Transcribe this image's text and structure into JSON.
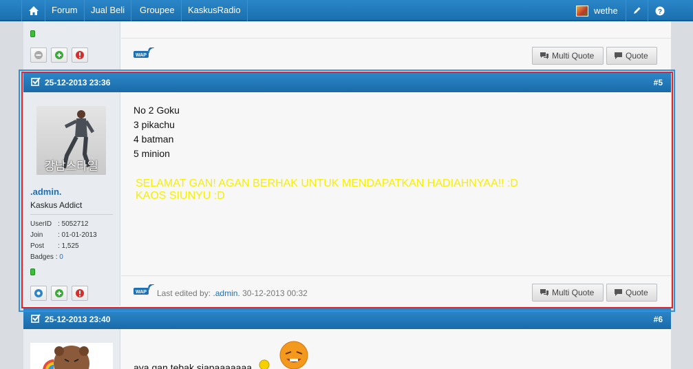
{
  "nav": {
    "items": [
      {
        "label": "Forum"
      },
      {
        "label": "Jual Beli"
      },
      {
        "label": "Groupee"
      },
      {
        "label": "KaskusRadio"
      }
    ],
    "username": "wethe"
  },
  "posts": [
    {
      "date": "25-12-2013 23:36",
      "number": "#5",
      "user": {
        "name": ".admin.",
        "rank": "Kaskus Addict",
        "avatar_caption": "강남스타일",
        "userid_label": "UserID",
        "userid": ": 5052712",
        "join_label": "Join",
        "join": ": 01-01-2013",
        "post_label": "Post",
        "post": ": 1,525",
        "badges_label": "Badges",
        "badges_sep": ":",
        "badges": "0"
      },
      "body_lines": [
        "No 2 Goku",
        "3 pikachu",
        "4 batman",
        "5 minion"
      ],
      "highlight_text_1": "SELAMAT GAN! AGAN BERHAK UNTUK MENDAPATKAN HADIAHNYAA!! :D",
      "highlight_text_2": "KAOS SIUNYU :D",
      "highlight_color": "#ffff00",
      "edited_prefix": "Last edited by:",
      "edited_user": ".admin.",
      "edited_date": "30-12-2013 00:32",
      "wap_label": "WAP",
      "multi_quote": "Multi Quote",
      "quote": "Quote"
    },
    {
      "date": "25-12-2013 23:40",
      "number": "#6",
      "body_partial": "aya gan tebak siapaaaaaaa"
    }
  ],
  "prev_post": {
    "wap_label": "WAP",
    "multi_quote": "Multi Quote",
    "quote": "Quote"
  }
}
